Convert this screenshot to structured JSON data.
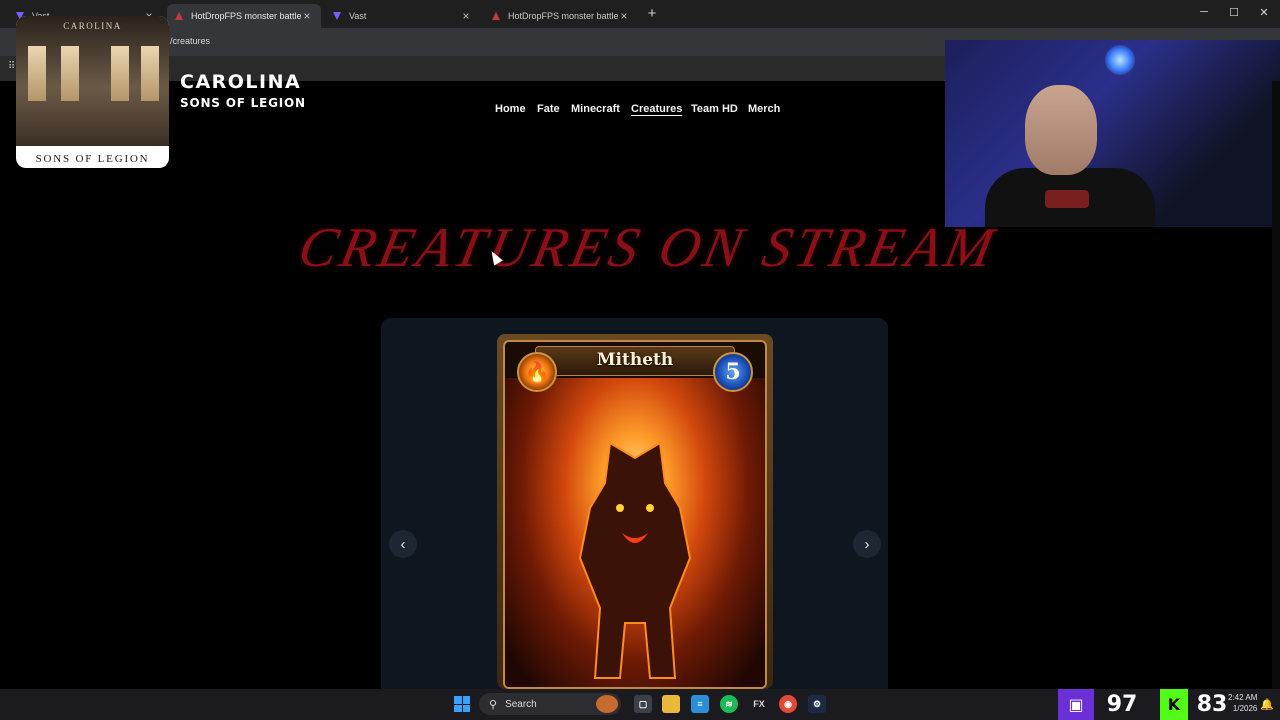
{
  "browser": {
    "tabs": [
      {
        "title": "Vast",
        "favicon_color": "#7b5cff"
      },
      {
        "title": "HotDropFPS monster battle sty",
        "favicon_color": "#c43a3a"
      },
      {
        "title": "Vast",
        "favicon_color": "#7b5cff"
      },
      {
        "title": "HotDropFPS monster battle sty",
        "favicon_color": "#c43a3a"
      }
    ],
    "new_tab": "+",
    "url_fragment": "/creatures",
    "window_controls": {
      "minimize": "─",
      "maximize": "☐",
      "close": "✕"
    }
  },
  "site": {
    "brand_line1": "CAROLINA",
    "brand_line2": "SONS OF LEGION",
    "nav": [
      {
        "label": "Home",
        "active": false
      },
      {
        "label": "Fate",
        "active": false
      },
      {
        "label": "Minecraft",
        "active": false
      },
      {
        "label": "Creatures",
        "active": true
      },
      {
        "label": "Team HD",
        "active": false
      },
      {
        "label": "Merch",
        "active": false
      }
    ],
    "hero_title": "CREATURES ON STREAM",
    "accent_color": "#8a0f16"
  },
  "carousel": {
    "prev": "‹",
    "next": "›",
    "card": {
      "name": "Mitheth",
      "cost": "5",
      "element_icon": "fire-icon",
      "element_glyph": "🔥"
    }
  },
  "logo_overlay": {
    "top_text": "CAROLINA",
    "bottom_text": "SONS OF LEGION"
  },
  "taskbar": {
    "search_placeholder": "Search",
    "widget_left_value": "97",
    "widget_right_value": "83",
    "clock_time": "2:42 AM",
    "clock_date": "1/2026"
  }
}
